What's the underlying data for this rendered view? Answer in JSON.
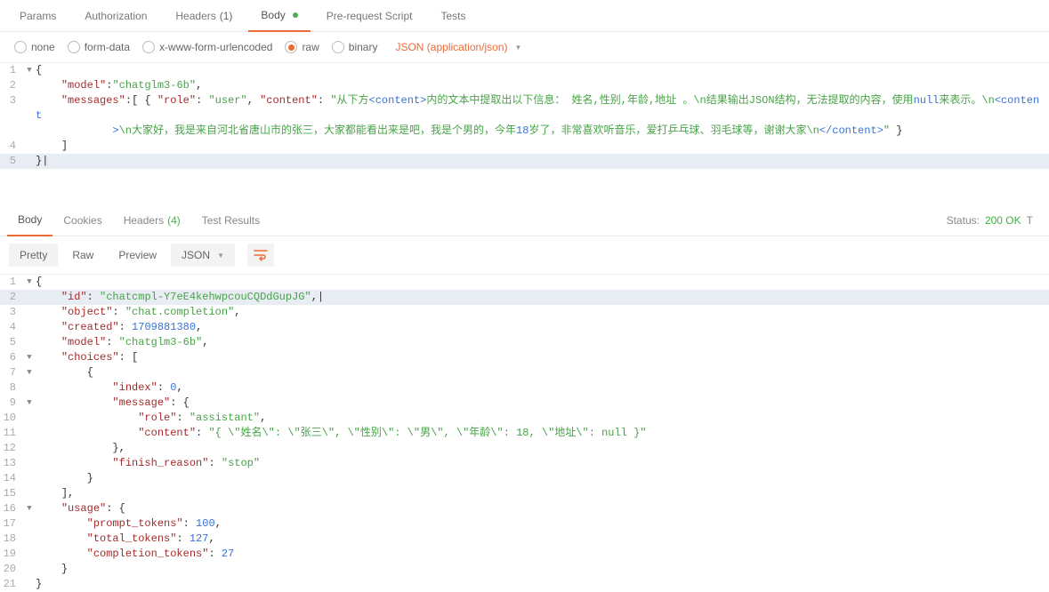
{
  "reqTabs": {
    "params": "Params",
    "authorization": "Authorization",
    "headers": "Headers",
    "headersCount": "(1)",
    "body": "Body",
    "prereq": "Pre-request Script",
    "tests": "Tests"
  },
  "bodyTypes": {
    "none": "none",
    "formdata": "form-data",
    "xform": "x-www-form-urlencoded",
    "raw": "raw",
    "binary": "binary",
    "json": "JSON (application/json)"
  },
  "reqCode": {
    "model": "chatglm3-6b",
    "contentPart1": "从下方",
    "tag1": "<content>",
    "contentPart2": "内的文本中提取出以下信息： 姓名,性别,年龄,地址 。\\n结果输出JSON结构，无法提取的内容，使用",
    "nullTok": "null",
    "contentPart3": "来表示。\\n",
    "tag2": "<content",
    "wrapLine": ">",
    "contentPart4": "\\n大家好，我是来自河北省唐山市的张三，大家都能看出来是吧，我是个男的，今年",
    "ageTok": "18",
    "contentPart5": "岁了，非常喜欢听音乐，爱打乒乓球、羽毛球等，谢谢大家\\n",
    "tag3": "</content>"
  },
  "respTabs": {
    "body": "Body",
    "cookies": "Cookies",
    "headers": "Headers",
    "headersCount": "(4)",
    "tests": "Test Results"
  },
  "status": {
    "label": "Status:",
    "value": "200 OK",
    "tail": "T"
  },
  "view": {
    "pretty": "Pretty",
    "raw": "Raw",
    "preview": "Preview",
    "json": "JSON"
  },
  "respCode": {
    "idKey": "id",
    "idVal": "chatcmpl-Y7eE4kehwpcouCQDdGupJG",
    "objKey": "object",
    "objVal": "chat.completion",
    "createdKey": "created",
    "createdVal": "1709881380",
    "modelKey": "model",
    "modelVal": "chatglm3-6b",
    "choicesKey": "choices",
    "indexKey": "index",
    "indexVal": "0",
    "messageKey": "message",
    "roleKey": "role",
    "roleVal": "assistant",
    "contentKey": "content",
    "contentVal": "{ \\\"姓名\\\": \\\"张三\\\", \\\"性别\\\": \\\"男\\\", \\\"年龄\\\": 18, \\\"地址\\\": null }",
    "finishKey": "finish_reason",
    "finishVal": "stop",
    "usageKey": "usage",
    "ptKey": "prompt_tokens",
    "ptVal": "100",
    "ttKey": "total_tokens",
    "ttVal": "127",
    "ctKey": "completion_tokens",
    "ctVal": "27"
  }
}
